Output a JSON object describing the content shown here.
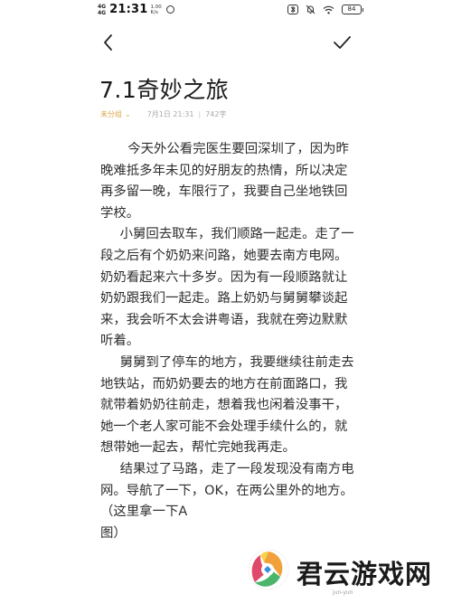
{
  "status_bar": {
    "network_top": "4G",
    "network_bottom": "4G",
    "time": "21:31",
    "speed_value": "1.00",
    "speed_unit": "K/s",
    "battery": "84"
  },
  "nav": {
    "back_icon": "chevron-left-icon",
    "done_icon": "checkmark-icon"
  },
  "note": {
    "title": "7.1奇妙之旅",
    "category": "未分组",
    "date": "7月1日 21:31",
    "separator": "|",
    "word_count": "742字",
    "paragraphs": [
      "今天外公看完医生要回深圳了，因为昨晚难抵多年未见的好朋友的热情，所以决定再多留一晚，车限行了，我要自己坐地铁回学校。",
      "小舅回去取车，我们顺路一起走。走了一段之后有个奶奶来问路，她要去南方电网。奶奶看起来六十多岁。因为有一段顺路就让奶奶跟我们一起走。路上奶奶与舅舅攀谈起来，我会听不太会讲粤语，我就在旁边默默听着。",
      "舅舅到了停车的地方，我要继续往前走去地铁站，而奶奶要去的地方在前面路口，我就带着奶奶往前走，想着我也闲着没事干，她一个老人家可能不会处理手续什么的，就想带她一起去，帮忙完她我再走。",
      "结果过了马路，走了一段发现没有南方电网。导航了一下，OK，在两公里外的地方。（这里拿一下A",
      "图）"
    ]
  },
  "watermark": {
    "text": "君云游戏网",
    "url": "jun-yun"
  },
  "colors": {
    "accent": "#d9a54a",
    "meta": "#a9a9a9",
    "text": "#2e2e2e"
  }
}
